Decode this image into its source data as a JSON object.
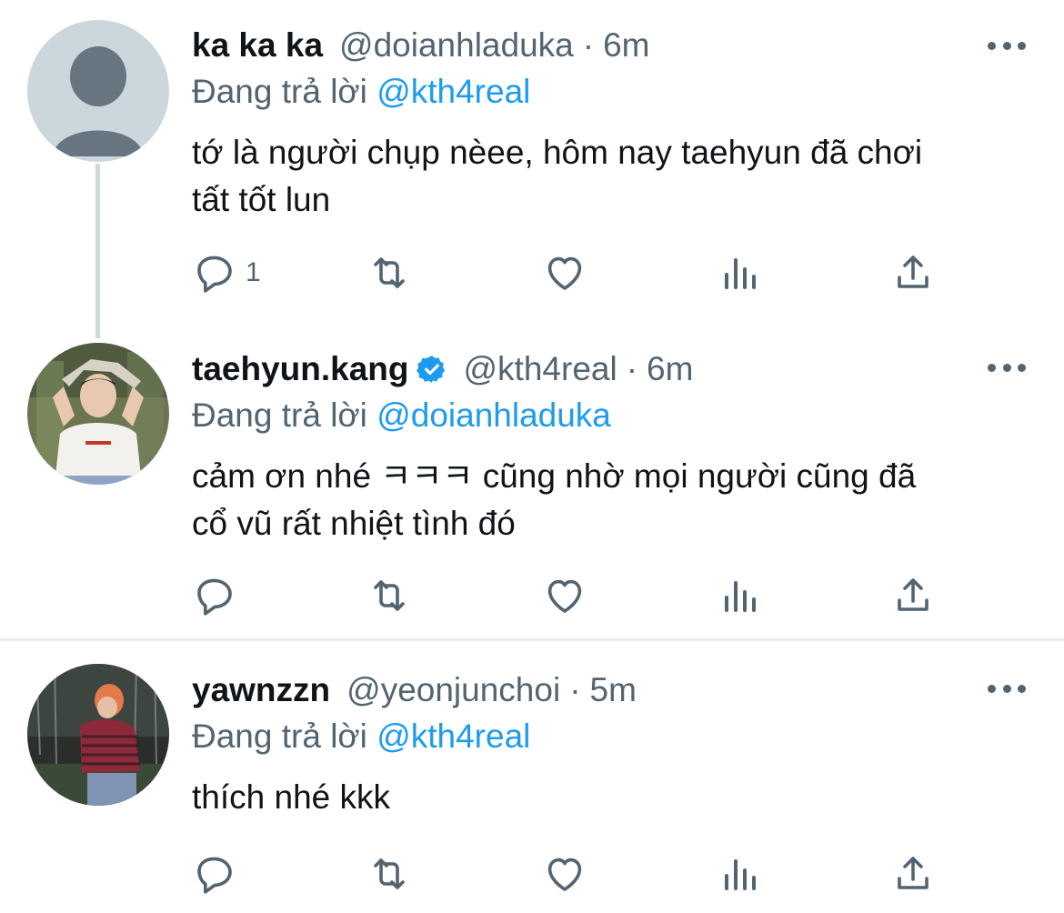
{
  "tweets": [
    {
      "name": "ka ka ka",
      "handle": "@doianhladuka",
      "separator": "·",
      "time": "6m",
      "reply_prefix": "Đang trả lời ",
      "reply_mention": "@kth4real",
      "text_lines": [
        "tớ là người chụp nèee, hôm nay taehyun đã chơi",
        "tất tốt lun"
      ],
      "reply_count": "1",
      "verified": false,
      "avatar": "default-profile-icon"
    },
    {
      "name": "taehyun.kang",
      "handle": "@kth4real",
      "separator": "·",
      "time": "6m",
      "reply_prefix": "Đang trả lời ",
      "reply_mention": "@doianhladuka",
      "text_lines": [
        "cảm ơn nhé ㅋㅋㅋ cũng nhờ mọi người cũng đã",
        "cổ vũ rất nhiệt tình đó"
      ],
      "reply_count": "",
      "verified": true,
      "avatar": "user-photo"
    },
    {
      "name": "yawnzzn",
      "handle": "@yeonjunchoi",
      "separator": "·",
      "time": "5m",
      "reply_prefix": "Đang trả lời ",
      "reply_mention": "@kth4real",
      "text_lines": [
        "thích nhé kkk"
      ],
      "reply_count": "",
      "verified": false,
      "avatar": "user-photo"
    }
  ],
  "icons": {
    "reply": "reply-icon",
    "retweet": "retweet-icon",
    "like": "heart-icon",
    "views": "views-icon",
    "share": "share-icon",
    "more": "more-icon",
    "verified": "verified-badge-icon"
  },
  "colors": {
    "accent": "#1d9bf0",
    "secondary_text": "#536471",
    "primary_text": "#0f1419",
    "thread_line": "#cfd9de"
  }
}
